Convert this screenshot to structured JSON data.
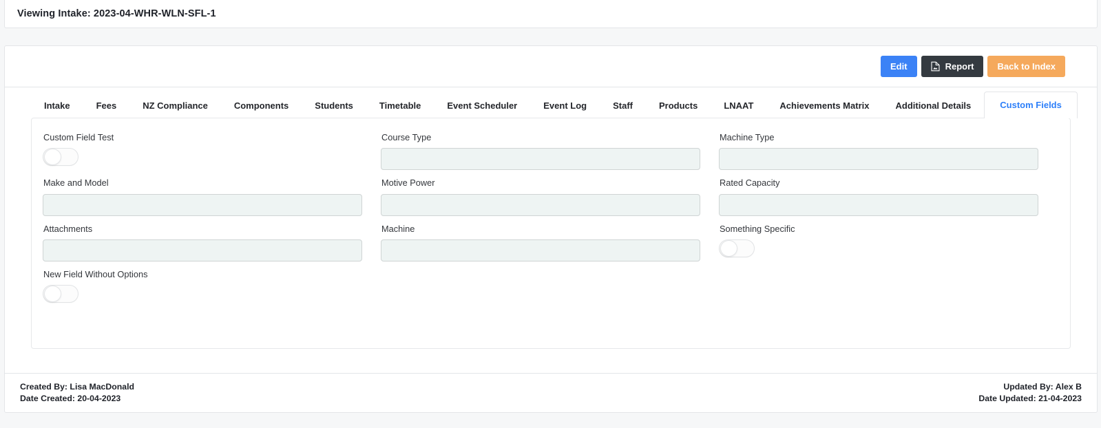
{
  "header": {
    "title": "Viewing Intake: 2023-04-WHR-WLN-SFL-1"
  },
  "toolbar": {
    "edit_label": "Edit",
    "report_label": "Report",
    "report_icon": "pdf-file-icon",
    "back_label": "Back to Index",
    "colors": {
      "edit": "#3b82f6",
      "report": "#343a40",
      "back": "#f5a95c"
    }
  },
  "tabs": {
    "active": "Custom Fields",
    "items": [
      {
        "label": "Intake"
      },
      {
        "label": "Fees"
      },
      {
        "label": "NZ Compliance"
      },
      {
        "label": "Components"
      },
      {
        "label": "Students"
      },
      {
        "label": "Timetable"
      },
      {
        "label": "Event Scheduler"
      },
      {
        "label": "Event Log"
      },
      {
        "label": "Staff"
      },
      {
        "label": "Products"
      },
      {
        "label": "LNAAT"
      },
      {
        "label": "Achievements Matrix"
      },
      {
        "label": "Additional Details"
      },
      {
        "label": "Custom Fields"
      }
    ]
  },
  "custom_fields": {
    "fields": [
      {
        "label": "Custom Field Test",
        "type": "toggle",
        "value": "off"
      },
      {
        "label": "Course Type",
        "type": "text",
        "value": "",
        "placeholder": ""
      },
      {
        "label": "Machine Type",
        "type": "text",
        "value": "",
        "placeholder": ""
      },
      {
        "label": "Make and Model",
        "type": "text",
        "value": "",
        "placeholder": ""
      },
      {
        "label": "Motive Power",
        "type": "text",
        "value": "",
        "placeholder": ""
      },
      {
        "label": "Rated Capacity",
        "type": "text",
        "value": "",
        "placeholder": ""
      },
      {
        "label": "Attachments",
        "type": "text",
        "value": "",
        "placeholder": ""
      },
      {
        "label": "Machine",
        "type": "text",
        "value": "",
        "placeholder": ""
      },
      {
        "label": "Something Specific",
        "type": "toggle",
        "value": "off"
      },
      {
        "label": "New Field Without Options",
        "type": "toggle",
        "value": "off"
      }
    ]
  },
  "footer": {
    "created_by": "Created By: Lisa MacDonald",
    "date_created": "Date Created: 20-04-2023",
    "updated_by": "Updated By: Alex B",
    "date_updated": "Date Updated: 21-04-2023"
  }
}
